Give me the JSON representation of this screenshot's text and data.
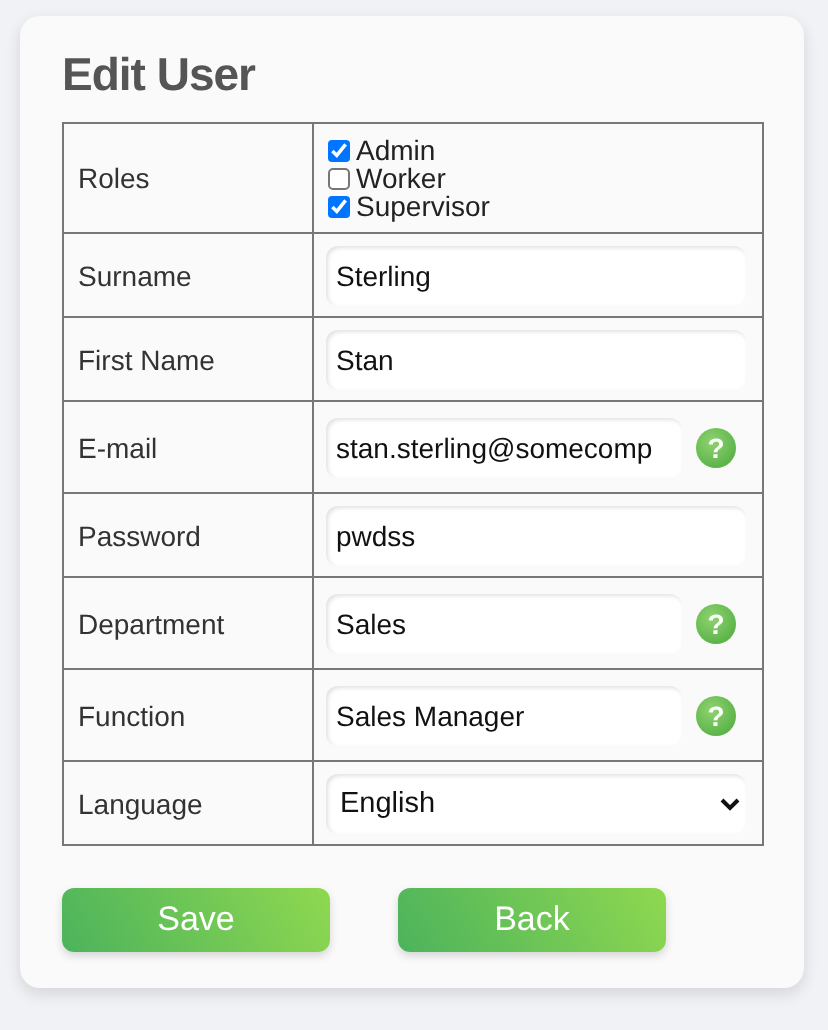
{
  "title": "Edit User",
  "rows": [
    {
      "kind": "checkboxes",
      "label": "Roles",
      "options": [
        {
          "label": "Admin",
          "checked": true
        },
        {
          "label": "Worker",
          "checked": false
        },
        {
          "label": "Supervisor",
          "checked": true
        }
      ]
    },
    {
      "kind": "input",
      "label": "Surname",
      "value": "Sterling"
    },
    {
      "kind": "input",
      "label": "First Name",
      "value": "Stan"
    },
    {
      "kind": "input",
      "label": "E-mail",
      "value": "stan.sterling@somecomp",
      "help": "?"
    },
    {
      "kind": "input",
      "label": "Password",
      "value": "pwdss"
    },
    {
      "kind": "input",
      "label": "Department",
      "value": "Sales",
      "help": "?"
    },
    {
      "kind": "input",
      "label": "Function",
      "value": "Sales Manager",
      "help": "?"
    },
    {
      "kind": "select",
      "label": "Language",
      "value": "English"
    }
  ],
  "buttons": [
    "Save",
    "Back"
  ]
}
